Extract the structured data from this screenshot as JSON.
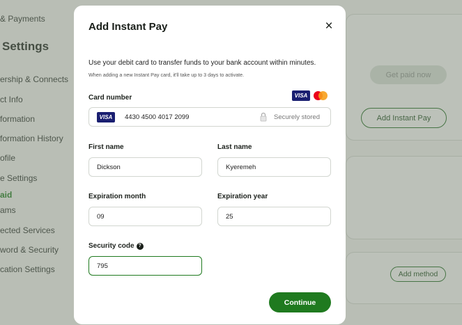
{
  "sidebar": {
    "title": "Settings",
    "items": [
      {
        "label": "& Payments"
      },
      {
        "label": "ership & Connects"
      },
      {
        "label": "ct Info"
      },
      {
        "label": "formation"
      },
      {
        "label": "formation History"
      },
      {
        "label": "ofile"
      },
      {
        "label": "e Settings"
      },
      {
        "label": "aid"
      },
      {
        "label": "ams"
      },
      {
        "label": "ected Services"
      },
      {
        "label": "word & Security"
      },
      {
        "label": "cation Settings"
      }
    ]
  },
  "background": {
    "get_paid_now": "Get paid now",
    "add_instant_pay": "Add Instant Pay",
    "add_method": "Add method"
  },
  "modal": {
    "title": "Add Instant Pay",
    "close_icon": "close-icon",
    "description": "Use your debit card to transfer funds to your bank account within minutes.",
    "note": "When adding a new Instant Pay card, it'll take up to 3 days to activate.",
    "card_number": {
      "label": "Card number",
      "brand_badge": "VISA",
      "value": "4430 4500 4017 2099",
      "secure_text": "Securely stored"
    },
    "first_name": {
      "label": "First name",
      "value": "Dickson"
    },
    "last_name": {
      "label": "Last name",
      "value": "Kyeremeh"
    },
    "expiration_month": {
      "label": "Expiration month",
      "value": "09"
    },
    "expiration_year": {
      "label": "Expiration year",
      "value": "25"
    },
    "security_code": {
      "label": "Security code",
      "value": "795",
      "help_glyph": "?"
    },
    "continue_label": "Continue"
  },
  "colors": {
    "accent": "#1f7a1f",
    "visa": "#1a1f71",
    "mastercard_red": "#eb001b",
    "mastercard_yellow": "#f79e1b"
  }
}
